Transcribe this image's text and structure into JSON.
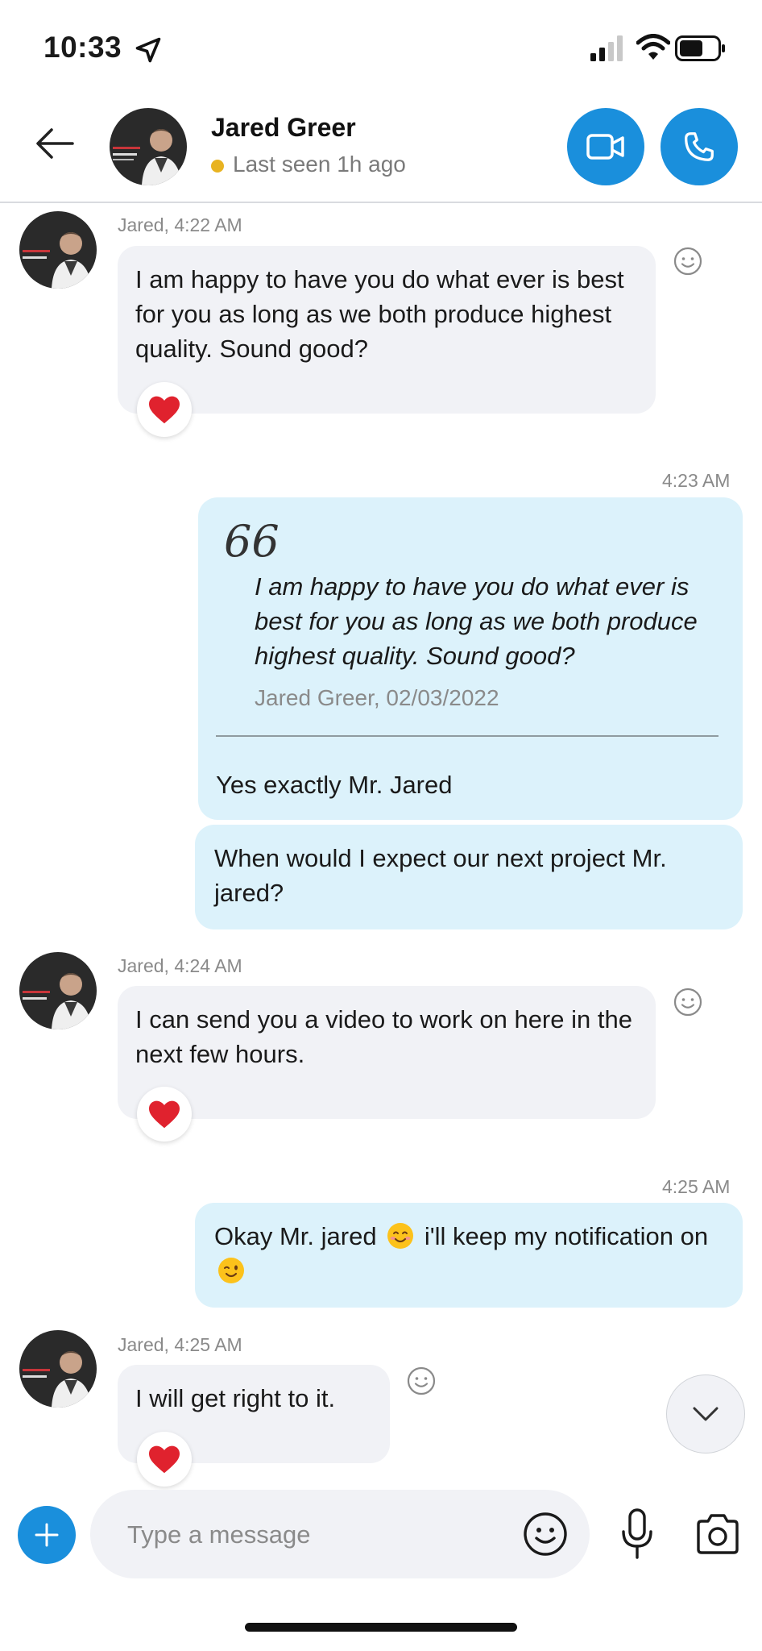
{
  "status_bar": {
    "time": "10:33"
  },
  "header": {
    "contact_name": "Jared Greer",
    "presence": "Last seen 1h ago"
  },
  "messages": [
    {
      "meta": "Jared, 4:22 AM",
      "text": "I am happy to have you do what ever is best for you as long as we both produce highest quality. Sound good?"
    },
    {
      "meta": "4:23 AM",
      "quote_mark": "66",
      "quote_text": "I am happy to have you do what ever is best for you as long as we both produce highest quality. Sound good?",
      "quote_attribution": "Jared Greer, 02/03/2022",
      "text": "Yes exactly Mr. Jared"
    },
    {
      "text": "When would I expect our next project Mr. jared?"
    },
    {
      "meta": "Jared, 4:24 AM",
      "text": "I can send you a video to work on here in the next few hours."
    },
    {
      "meta": "4:25 AM",
      "text_before": "Okay Mr. jared",
      "text_after": "i'll keep my notification on"
    },
    {
      "meta": "Jared, 4:25 AM",
      "text": "I will get right to it."
    }
  ],
  "composer": {
    "placeholder": "Type a message"
  },
  "colors": {
    "accent": "#1a8fdc",
    "incoming_bubble": "#f1f2f6",
    "outgoing_bubble": "#dcf2fb",
    "heart": "#e0222e",
    "presence": "#e8b321"
  }
}
